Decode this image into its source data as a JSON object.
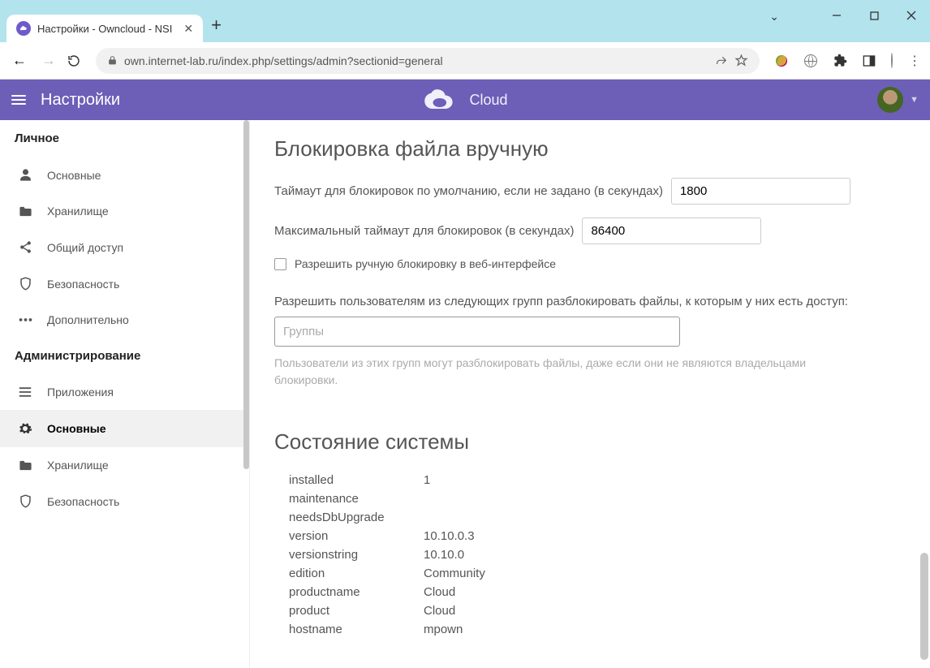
{
  "browser": {
    "tab_title": "Настройки - Owncloud - NSI",
    "url": "own.internet-lab.ru/index.php/settings/admin?sectionid=general"
  },
  "app": {
    "header": "Настройки",
    "brand": "Cloud"
  },
  "sidebar": {
    "section_personal": "Личное",
    "personal_items": [
      {
        "icon": "person",
        "label": "Основные"
      },
      {
        "icon": "folder",
        "label": "Хранилище"
      },
      {
        "icon": "share",
        "label": "Общий доступ"
      },
      {
        "icon": "shield",
        "label": "Безопасность"
      },
      {
        "icon": "dots",
        "label": "Дополнительно"
      }
    ],
    "section_admin": "Администрирование",
    "admin_items": [
      {
        "icon": "list",
        "label": "Приложения"
      },
      {
        "icon": "gear",
        "label": "Основные",
        "active": true
      },
      {
        "icon": "folder",
        "label": "Хранилище"
      },
      {
        "icon": "shield",
        "label": "Безопасность"
      }
    ]
  },
  "filelock": {
    "title": "Блокировка файла вручную",
    "timeout_label": "Таймаут для блокировок по умолчанию, если не задано (в секундах)",
    "timeout_value": "1800",
    "max_label": "Максимальный таймаут для блокировок (в секундах)",
    "max_value": "86400",
    "allow_label": "Разрешить ручную блокировку в веб-интерфейсе",
    "groups_label": "Разрешить пользователям из следующих групп разблокировать файлы, к которым у них есть доступ:",
    "groups_placeholder": "Группы",
    "groups_help": "Пользователи из этих групп могут разблокировать файлы, даже если они не являются владельцами блокировки."
  },
  "system": {
    "title": "Состояние системы",
    "rows": [
      {
        "k": "installed",
        "v": "1"
      },
      {
        "k": "maintenance",
        "v": ""
      },
      {
        "k": "needsDbUpgrade",
        "v": ""
      },
      {
        "k": "version",
        "v": "10.10.0.3"
      },
      {
        "k": "versionstring",
        "v": "10.10.0"
      },
      {
        "k": "edition",
        "v": "Community"
      },
      {
        "k": "productname",
        "v": "Cloud"
      },
      {
        "k": "product",
        "v": "Cloud"
      },
      {
        "k": "hostname",
        "v": "mpown"
      }
    ]
  }
}
